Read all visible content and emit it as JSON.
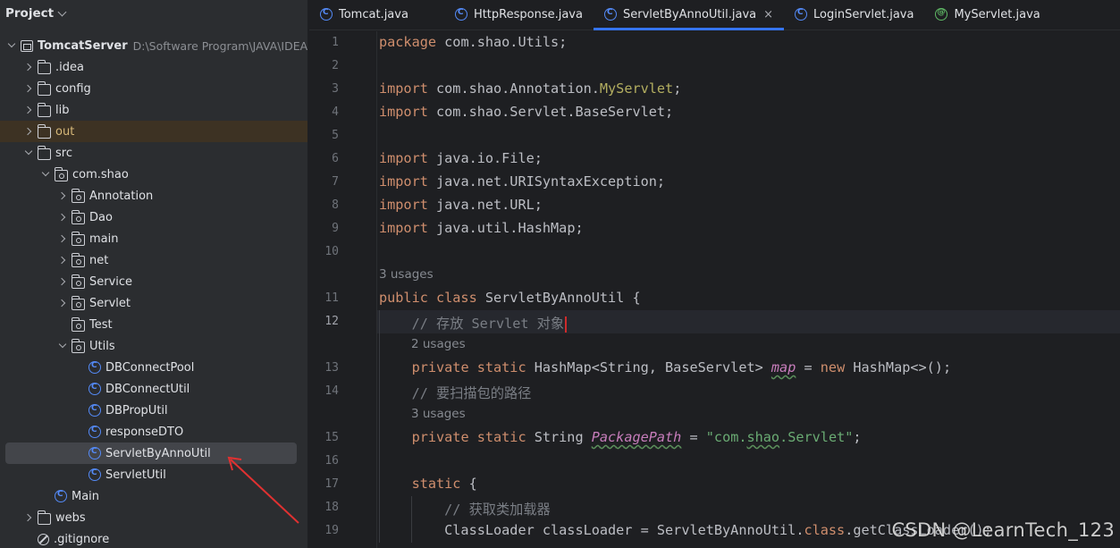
{
  "project_panel": {
    "title": "Project",
    "tree": [
      {
        "label": "TomcatServer",
        "path": "D:\\Software Program\\JAVA\\IDEA\\",
        "icon": "project-icon",
        "arrow": "down",
        "indent": 0,
        "bold": true
      },
      {
        "label": ".idea",
        "icon": "folder-icon",
        "arrow": "right",
        "indent": 1
      },
      {
        "label": "config",
        "icon": "folder-icon",
        "arrow": "right",
        "indent": 1
      },
      {
        "label": "lib",
        "icon": "folder-icon",
        "arrow": "right",
        "indent": 1
      },
      {
        "label": "out",
        "icon": "folder-icon",
        "arrow": "right",
        "indent": 1,
        "highlight": "excluded"
      },
      {
        "label": "src",
        "icon": "folder-icon",
        "arrow": "down",
        "indent": 1
      },
      {
        "label": "com.shao",
        "icon": "package-icon",
        "arrow": "down",
        "indent": 2
      },
      {
        "label": "Annotation",
        "icon": "package-icon",
        "arrow": "right",
        "indent": 3
      },
      {
        "label": "Dao",
        "icon": "package-icon",
        "arrow": "right",
        "indent": 3
      },
      {
        "label": "main",
        "icon": "package-icon",
        "arrow": "right",
        "indent": 3
      },
      {
        "label": "net",
        "icon": "package-icon",
        "arrow": "right",
        "indent": 3
      },
      {
        "label": "Service",
        "icon": "package-icon",
        "arrow": "right",
        "indent": 3
      },
      {
        "label": "Servlet",
        "icon": "package-icon",
        "arrow": "right",
        "indent": 3
      },
      {
        "label": "Test",
        "icon": "package-icon",
        "arrow": "none",
        "indent": 3
      },
      {
        "label": "Utils",
        "icon": "package-icon",
        "arrow": "down",
        "indent": 3
      },
      {
        "label": "DBConnectPool",
        "icon": "class-icon",
        "arrow": "none",
        "indent": 4
      },
      {
        "label": "DBConnectUtil",
        "icon": "class-icon",
        "arrow": "none",
        "indent": 4
      },
      {
        "label": "DBPropUtil",
        "icon": "class-icon",
        "arrow": "none",
        "indent": 4
      },
      {
        "label": "responseDTO",
        "icon": "class-icon",
        "arrow": "none",
        "indent": 4
      },
      {
        "label": "ServletByAnnoUtil",
        "icon": "class-icon",
        "arrow": "none",
        "indent": 4,
        "selected": true
      },
      {
        "label": "ServletUtil",
        "icon": "class-icon",
        "arrow": "none",
        "indent": 4
      },
      {
        "label": "Main",
        "icon": "class-icon",
        "arrow": "none",
        "indent": 2
      },
      {
        "label": "webs",
        "icon": "folder-icon",
        "arrow": "right",
        "indent": 1
      },
      {
        "label": ".gitignore",
        "icon": "ignore-icon",
        "arrow": "none",
        "indent": 1
      }
    ]
  },
  "tabs": [
    {
      "label": "Tomcat.java",
      "icon": "class-icon",
      "active": false
    },
    {
      "label": "HttpResponse.java",
      "icon": "class-icon",
      "active": false
    },
    {
      "label": "ServletByAnnoUtil.java",
      "icon": "class-icon",
      "active": true,
      "close": "×"
    },
    {
      "label": "LoginServlet.java",
      "icon": "class-icon",
      "active": false
    },
    {
      "label": "MyServlet.java",
      "icon": "annotation-icon",
      "active": false
    }
  ],
  "editor": {
    "current_line": 12,
    "lines": [
      {
        "kind": "code",
        "num": "1",
        "tokens": [
          [
            "kw",
            "package "
          ],
          [
            "",
            "com.shao.Utils;"
          ]
        ]
      },
      {
        "kind": "code",
        "num": "2",
        "tokens": []
      },
      {
        "kind": "code",
        "num": "3",
        "tokens": [
          [
            "kw",
            "import "
          ],
          [
            "",
            "com.shao.Annotation."
          ],
          [
            "an",
            "MyServlet"
          ],
          [
            "",
            ";"
          ]
        ]
      },
      {
        "kind": "code",
        "num": "4",
        "tokens": [
          [
            "kw",
            "import "
          ],
          [
            "",
            "com.shao.Servlet.BaseServlet;"
          ]
        ]
      },
      {
        "kind": "code",
        "num": "5",
        "tokens": []
      },
      {
        "kind": "code",
        "num": "6",
        "tokens": [
          [
            "kw",
            "import "
          ],
          [
            "",
            "java.io.File;"
          ]
        ]
      },
      {
        "kind": "code",
        "num": "7",
        "tokens": [
          [
            "kw",
            "import "
          ],
          [
            "",
            "java.net.URISyntaxException;"
          ]
        ]
      },
      {
        "kind": "code",
        "num": "8",
        "tokens": [
          [
            "kw",
            "import "
          ],
          [
            "",
            "java.net.URL;"
          ]
        ]
      },
      {
        "kind": "code",
        "num": "9",
        "tokens": [
          [
            "kw",
            "import "
          ],
          [
            "",
            "java.util.HashMap;"
          ]
        ]
      },
      {
        "kind": "code",
        "num": "10",
        "tokens": []
      },
      {
        "kind": "hint",
        "text": "3 usages",
        "indent": 0
      },
      {
        "kind": "code",
        "num": "11",
        "tokens": [
          [
            "kw",
            "public class "
          ],
          [
            "",
            "ServletByAnnoUtil {"
          ]
        ]
      },
      {
        "kind": "code",
        "num": "12",
        "tokens": [
          [
            "",
            "    "
          ],
          [
            "cm",
            "// 存放 Servlet 对象"
          ]
        ],
        "caret": true
      },
      {
        "kind": "hint",
        "text": "2 usages",
        "indent": 1
      },
      {
        "kind": "code",
        "num": "13",
        "tokens": [
          [
            "",
            "    "
          ],
          [
            "kw",
            "private static "
          ],
          [
            "",
            "HashMap<String, BaseServlet> "
          ],
          [
            "fd",
            "map"
          ],
          [
            "",
            " = "
          ],
          [
            "kw",
            "new "
          ],
          [
            "",
            "HashMap<>();"
          ]
        ]
      },
      {
        "kind": "code",
        "num": "14",
        "tokens": [
          [
            "",
            "    "
          ],
          [
            "cm",
            "// 要扫描包的路径"
          ]
        ]
      },
      {
        "kind": "hint",
        "text": "3 usages",
        "indent": 1
      },
      {
        "kind": "code",
        "num": "15",
        "tokens": [
          [
            "",
            "    "
          ],
          [
            "kw",
            "private static "
          ],
          [
            "",
            "String "
          ],
          [
            "fd",
            "PackagePath"
          ],
          [
            "",
            " = "
          ],
          [
            "st",
            "\"com."
          ],
          [
            "stul",
            "shao"
          ],
          [
            "st",
            ".Servlet\""
          ],
          [
            "",
            ";"
          ]
        ]
      },
      {
        "kind": "code",
        "num": "16",
        "tokens": []
      },
      {
        "kind": "code",
        "num": "17",
        "tokens": [
          [
            "",
            "    "
          ],
          [
            "kw",
            "static "
          ],
          [
            "",
            "{"
          ]
        ]
      },
      {
        "kind": "code",
        "num": "18",
        "tokens": [
          [
            "",
            "        "
          ],
          [
            "cm",
            "// 获取类加载器"
          ]
        ]
      },
      {
        "kind": "code",
        "num": "19",
        "tokens": [
          [
            "",
            "        ClassLoader classLoader = ServletByAnnoUtil."
          ],
          [
            "kw",
            "class"
          ],
          [
            "",
            ".getClassLoader();"
          ]
        ]
      }
    ]
  },
  "watermark": "CSDN @LearnTech_123",
  "colors": {
    "accent": "#3574f0",
    "keyword": "#cf8e6d",
    "annotation": "#b3ae60",
    "comment": "#7a7e85",
    "string": "#6aab73",
    "field": "#c77dbb",
    "arrow": "#e03131"
  }
}
